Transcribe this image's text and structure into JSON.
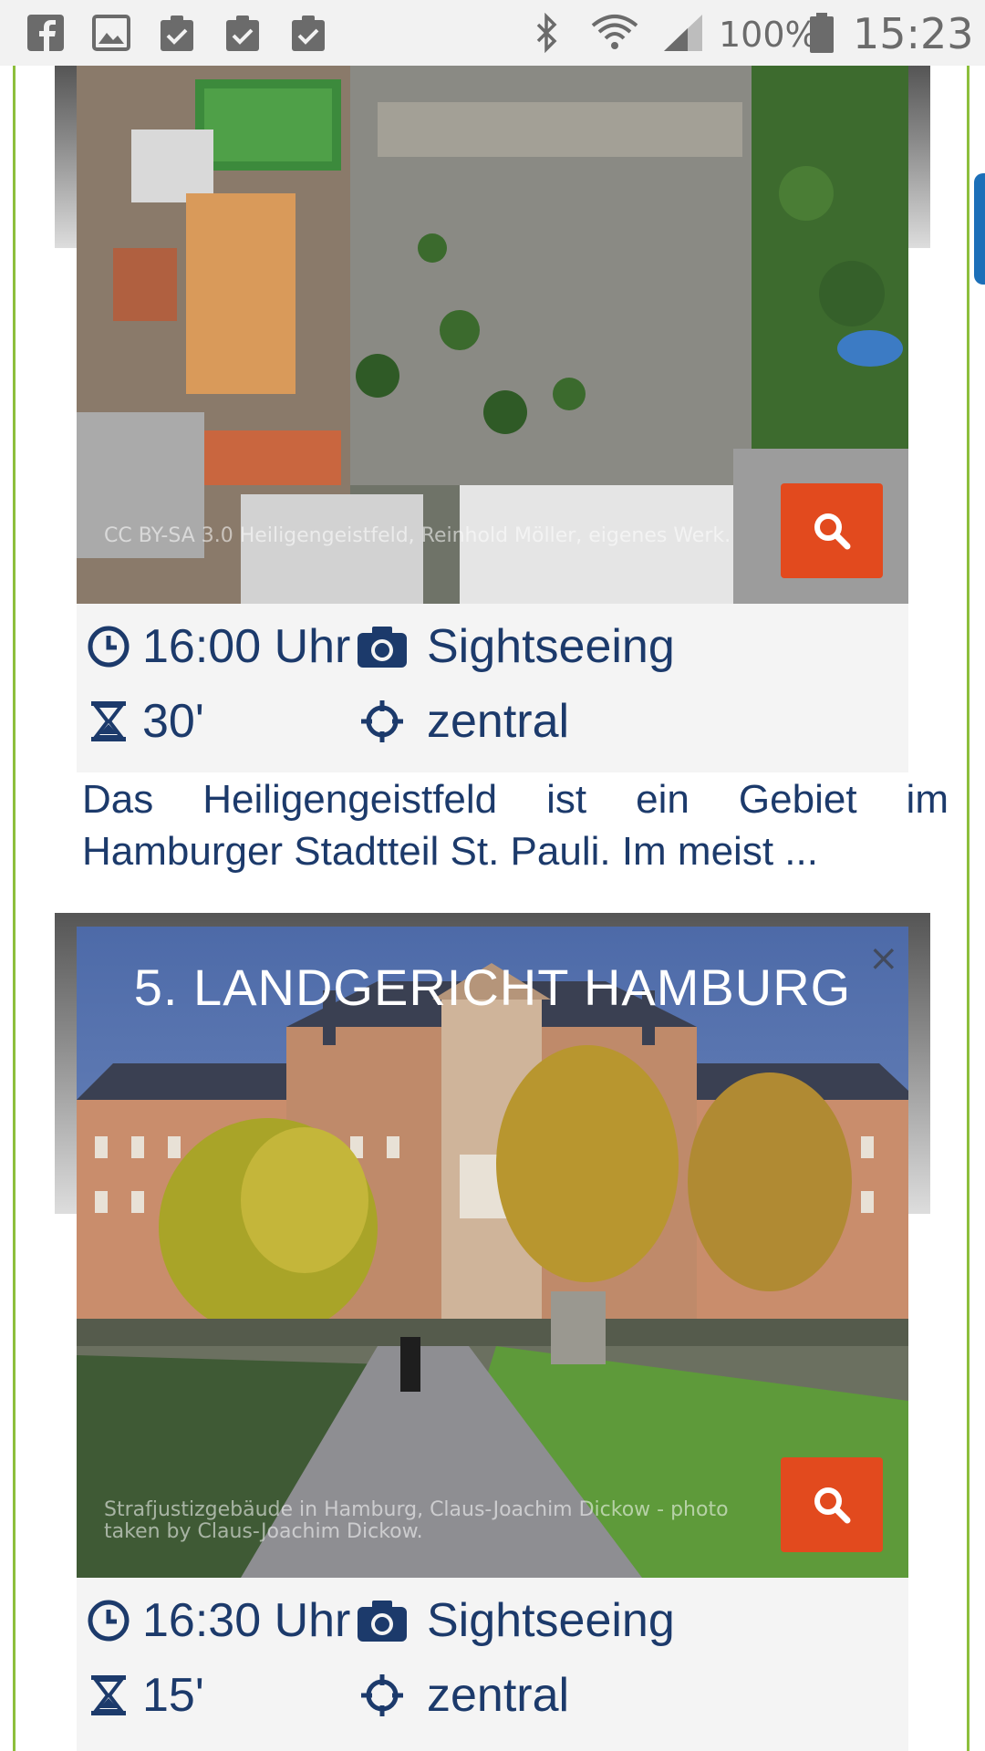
{
  "status_bar": {
    "icons": [
      "facebook-icon",
      "gallery-icon",
      "clipboard-check-icon",
      "clipboard-check-icon",
      "clipboard-check-icon",
      "bluetooth-icon",
      "wifi-icon",
      "signal-icon",
      "battery-icon"
    ],
    "battery": "100%",
    "time": "15:23"
  },
  "colors": {
    "frame": "#8dbf3c",
    "accent": "#e24a1e",
    "text": "#1c3a6b",
    "side_tab": "#1c6fb8"
  },
  "cards": [
    {
      "caption": "CC BY-SA 3.0 Heiligengeistfeld, Reinhold Möller, eigenes Werk.",
      "time": "16:00 Uhr",
      "category": "Sightseeing",
      "duration": "30'",
      "location": "zentral",
      "description": "Das Heiligengeistfeld ist ein Gebiet im Hamburger Stadtteil St. Pauli. Im meist ..."
    },
    {
      "title": "5. LANDGERICHT HAMBURG",
      "close": "×",
      "caption": "Strafjustizgebäude in Hamburg, Claus-Joachim Dickow - photo taken by Claus-Joachim Dickow.",
      "time": "16:30 Uhr",
      "category": "Sightseeing",
      "duration": "15'",
      "location": "zentral"
    }
  ]
}
